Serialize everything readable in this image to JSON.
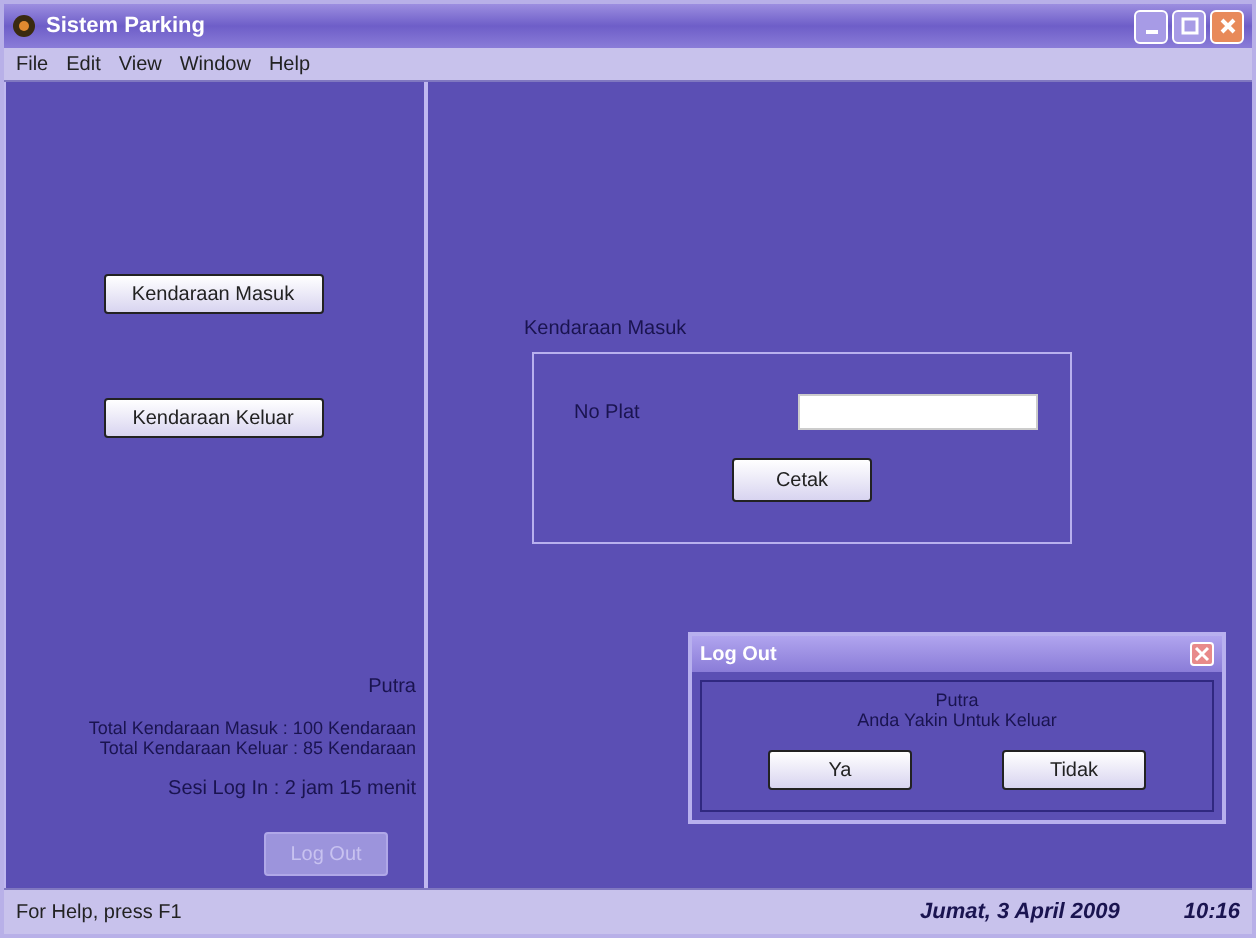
{
  "window": {
    "title": "Sistem Parking",
    "controls": [
      {
        "kind": "minimize"
      },
      {
        "kind": "maximize"
      },
      {
        "kind": "close"
      }
    ]
  },
  "menu": [
    "File",
    "Edit",
    "View",
    "Window",
    "Help"
  ],
  "left_panel": {
    "buttons": [
      "Kendaraan Masuk",
      "Kendaraan Keluar"
    ],
    "user": "Putra",
    "stats": [
      "Total Kendaraan Masuk : 100 Kendaraan",
      "Total Kendaraan Keluar : 85 Kendaraan"
    ],
    "session": "Sesi Log In : 2 jam 15 menit",
    "logout_button": {
      "label": "Log Out",
      "disabled": true
    }
  },
  "entry_group": {
    "title": "Kendaraan Masuk",
    "field_label": "No Plat",
    "print_button": "Cetak"
  },
  "dialog": {
    "title": "Log Out",
    "message": [
      "Putra",
      "Anda Yakin Untuk Keluar"
    ],
    "buttons": [
      "Ya",
      "Tidak"
    ]
  },
  "status_bar": {
    "help": "For Help, press F1",
    "date": "Jumat, 3 April 2009",
    "time": "10:16"
  }
}
